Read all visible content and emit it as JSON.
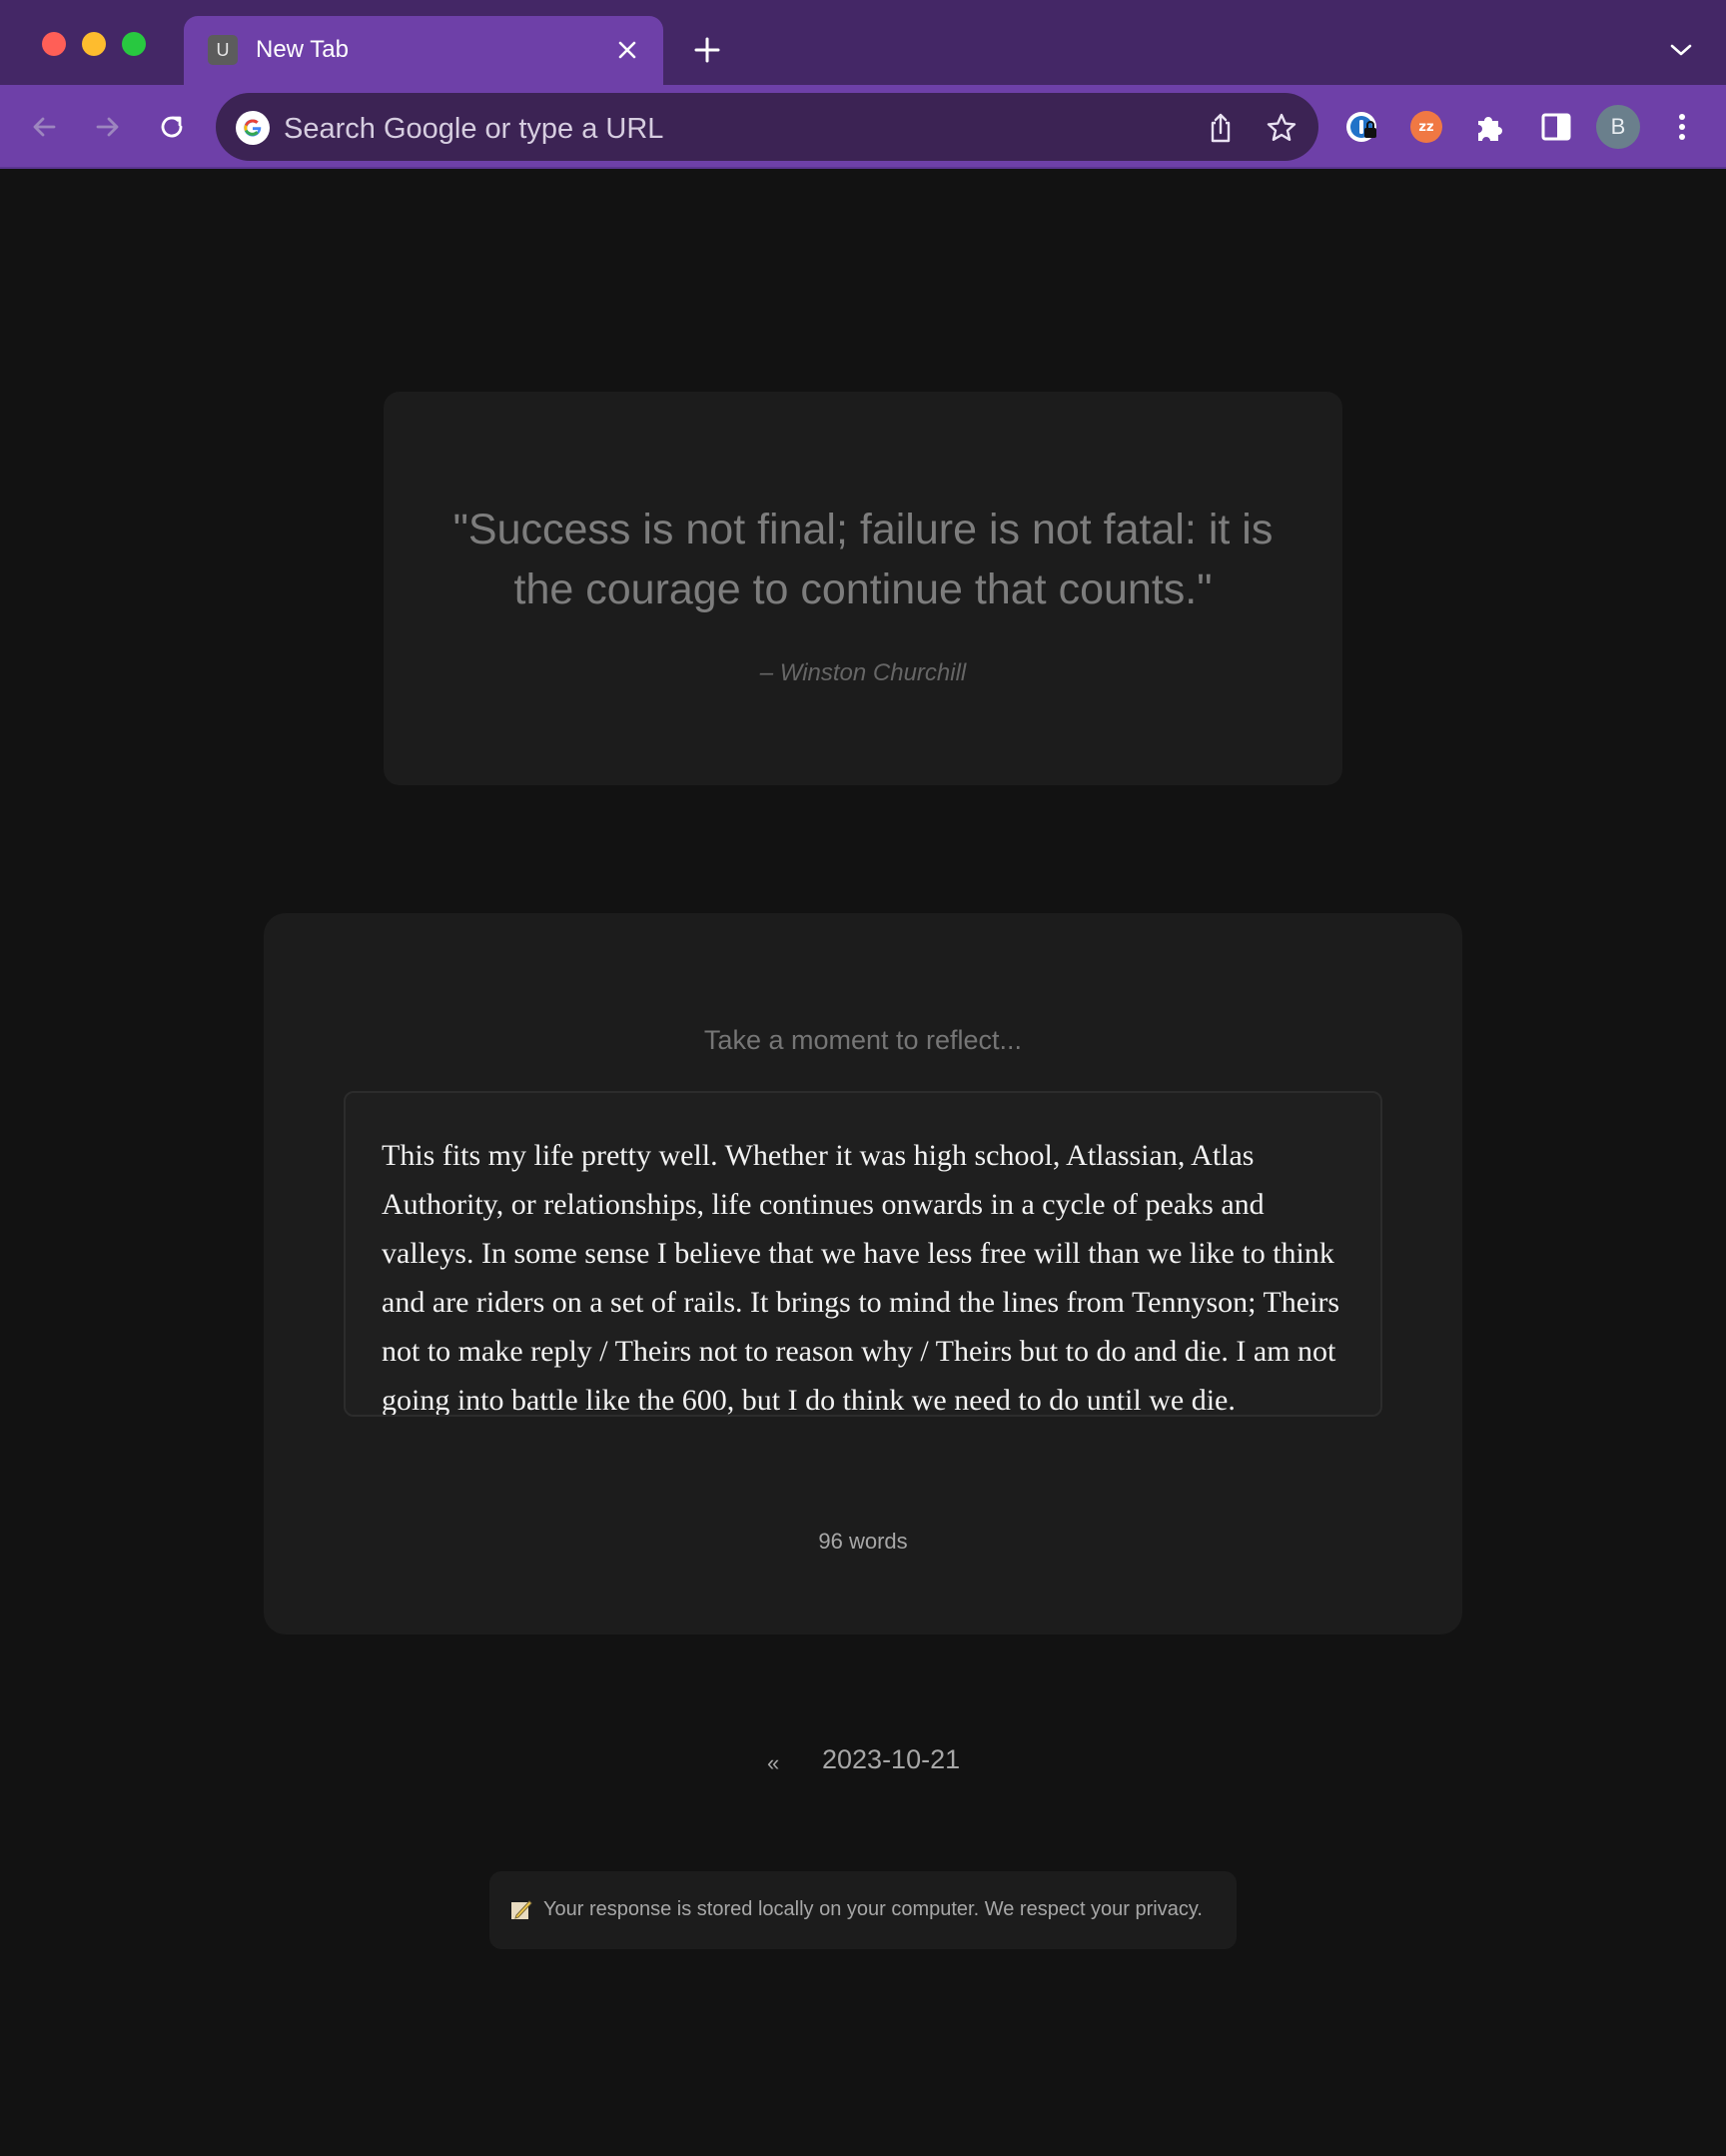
{
  "browser": {
    "tab": {
      "favicon_letter": "U",
      "title": "New Tab"
    },
    "omnibox": {
      "placeholder": "Search Google or type a URL"
    },
    "profile": {
      "initial": "B"
    },
    "icons": {
      "close": "close-icon",
      "new_tab": "plus-icon",
      "tab_search": "chevron-down-icon",
      "back": "arrow-left-icon",
      "forward": "arrow-right-icon",
      "reload": "reload-icon",
      "google": "google-g-icon",
      "share": "share-icon",
      "bookmark": "star-icon",
      "extensions": [
        "password-manager-extension-icon",
        "snooze-extension-icon",
        "puzzle-icon",
        "side-panel-icon"
      ],
      "menu": "kebab-menu-icon"
    },
    "colors": {
      "tab_strip": "#442766",
      "active_tab_and_toolbar": "#6e40a8"
    }
  },
  "quote": {
    "text": "\"Success is not final; failure is not fatal: it is the courage to continue that counts.\"",
    "author": "– Winston Churchill"
  },
  "reflection": {
    "prompt": "Take a moment to reflect...",
    "response": "This fits my life pretty well. Whether it was high school, Atlassian, Atlas Authority, or relationships, life continues onwards in a cycle of peaks and valleys. In some sense I believe that we have less free will than we like to think and are riders on a set of rails. It brings to mind the lines from Tennyson; Theirs not to make reply / Theirs not to reason why / Theirs but to do and die. I am not going into battle like the 600, but I do think we need to do until we die.",
    "word_count": "96 words"
  },
  "date_nav": {
    "prev_label": "«",
    "date": "2023-10-21"
  },
  "privacy": {
    "icon": "pencil-paper-icon",
    "text": "Your response is stored locally on your computer. We respect your privacy."
  }
}
